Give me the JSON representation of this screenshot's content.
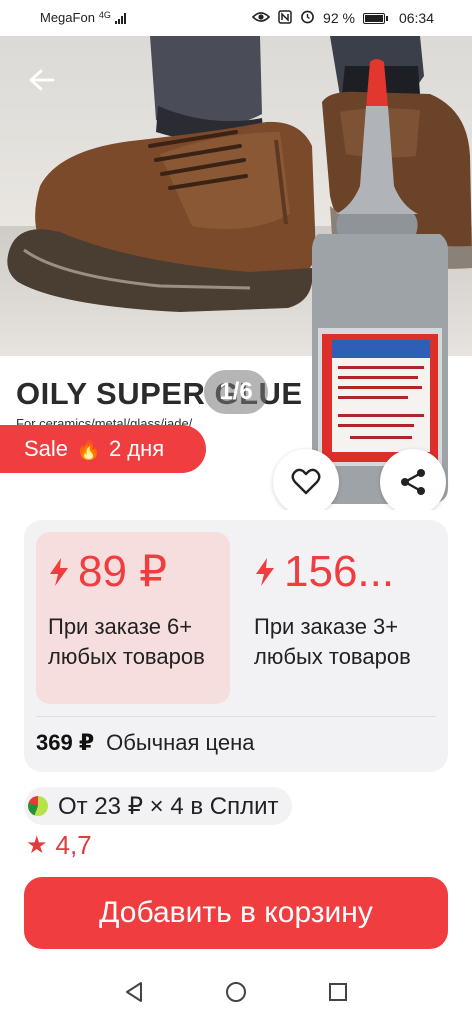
{
  "status_bar": {
    "carrier": "MegaFon",
    "network": "4G",
    "battery": "92 %",
    "battery_level": 0.92,
    "time": "06:34",
    "icons": [
      "eye-icon",
      "nfc-icon",
      "alarm-icon",
      "battery-icon"
    ]
  },
  "hero": {
    "product_name": "OILY SUPER GLUE",
    "product_subtitle": "For ceramics/metal/glass/jade/",
    "page_counter": "1/6",
    "sale_badge": "Sale",
    "sale_days": "2 дня",
    "icons": [
      "back-arrow-icon",
      "fire-icon",
      "heart-icon",
      "share-icon"
    ]
  },
  "pricing": {
    "tiers": [
      {
        "price": "89 ₽",
        "condition": "При заказе 6+ любых товаров",
        "active": true
      },
      {
        "price": "156...",
        "condition": "При заказе 3+ любых товаров",
        "active": false
      }
    ],
    "regular_price": "369 ₽",
    "regular_label": "Обычная цена"
  },
  "split": {
    "text": "От 23 ₽ × 4 в Сплит"
  },
  "rating": {
    "value": "4,7"
  },
  "cart_button": "Добавить в корзину",
  "nav": {
    "icons": [
      "back-triangle-icon",
      "home-circle-icon",
      "recents-square-icon"
    ]
  },
  "colors": {
    "accent": "#ef3d40",
    "tier_active_bg": "#f7dede",
    "card_bg": "#f2f2f5"
  }
}
